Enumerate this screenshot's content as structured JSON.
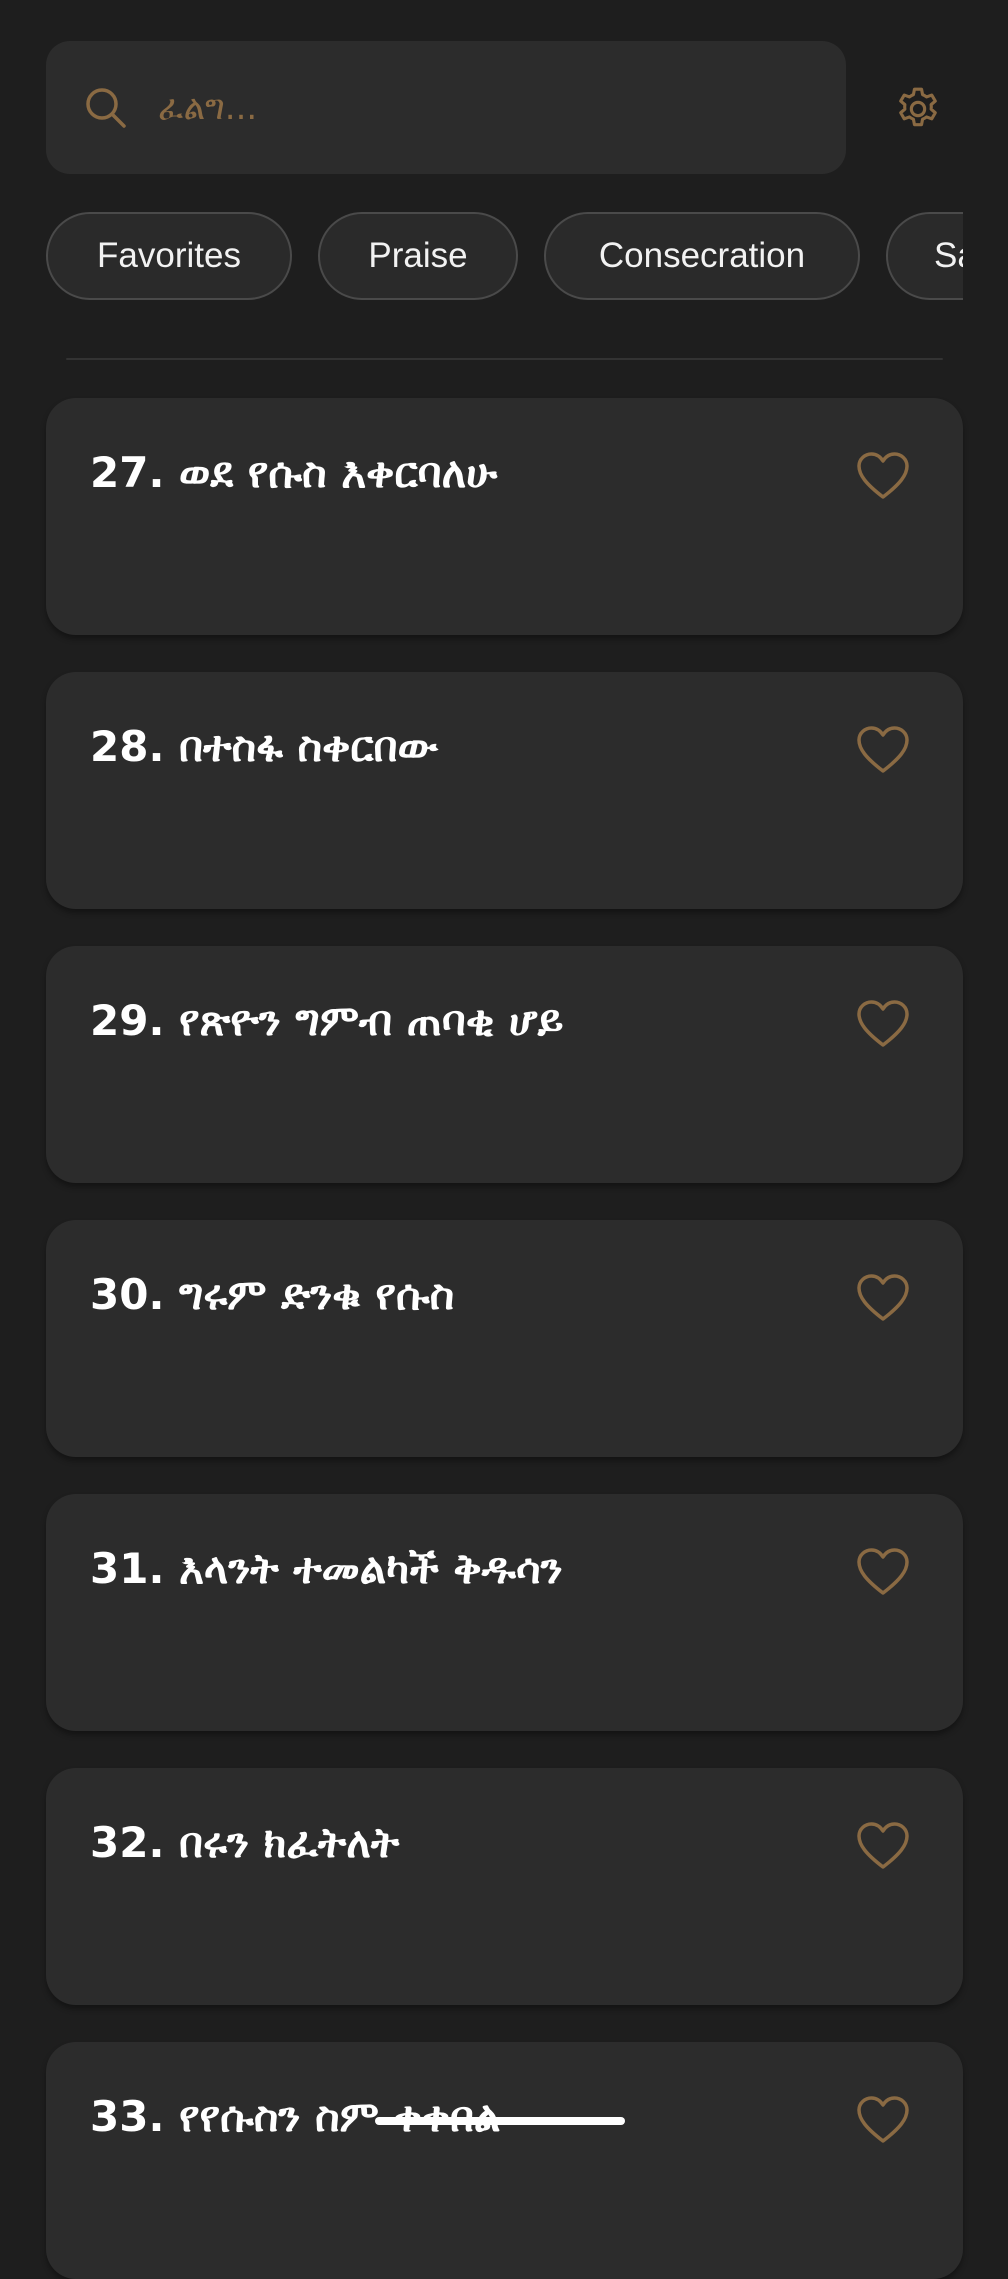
{
  "search": {
    "placeholder": "ፈልግ..."
  },
  "icons": {
    "search": "search-icon",
    "settings": "gear-icon",
    "favorite": "heart-outline-icon"
  },
  "colors": {
    "background": "#1e1e1e",
    "card": "#2c2c2c",
    "accent": "#8a6a43"
  },
  "chips": [
    {
      "label": "Favorites"
    },
    {
      "label": "Praise"
    },
    {
      "label": "Consecration"
    },
    {
      "label": "Sa"
    }
  ],
  "songs": [
    {
      "title": "27. ወደ የሱስ እቀርባለሁ"
    },
    {
      "title": "28. በተስፋ ስቀርበው"
    },
    {
      "title": "29. የጽዮን ግምብ ጠባቂ ሆይ"
    },
    {
      "title": "30. ግሩም ድንቁ የሱስ"
    },
    {
      "title": "31. እላንት ተመልካች ቅዱሳን"
    },
    {
      "title": "32. በሩን ክፈትለት"
    },
    {
      "title": "33. የየሱስን ስም ቀቀበል"
    }
  ]
}
